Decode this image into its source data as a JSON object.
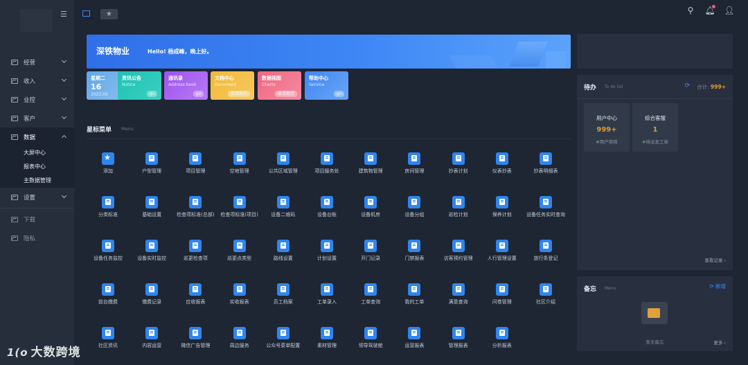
{
  "sidebar": {
    "items": [
      {
        "label": "经营"
      },
      {
        "label": "收入"
      },
      {
        "label": "业控"
      },
      {
        "label": "客户"
      },
      {
        "label": "数据"
      },
      {
        "label": "设置"
      },
      {
        "label": "下载"
      },
      {
        "label": "隐私"
      }
    ],
    "sub_items": [
      {
        "label": "大屏中心"
      },
      {
        "label": "报表中心"
      },
      {
        "label": "主数据管理"
      }
    ]
  },
  "banner": {
    "brand": "深铁物业",
    "greeting": "Hello! 杨成峰，晚上好。"
  },
  "quick_cards": [
    {
      "title": "星期二",
      "num": "16",
      "sub": "2023.05",
      "color": "#5fa6e8"
    },
    {
      "title": "资讯公告",
      "sub": "Notice",
      "go": "go",
      "color": "#1fc2b4"
    },
    {
      "title": "通讯录",
      "sub": "Address book",
      "go": "go",
      "color": "#a55ef0"
    },
    {
      "title": "文档中心",
      "sub": "Document",
      "go": "敬请期待",
      "color": "#f2b83a"
    },
    {
      "title": "数据视图",
      "sub": "Charts",
      "go": "敬请期待",
      "color": "#f07088"
    },
    {
      "title": "帮助中心",
      "sub": "Service",
      "go": "go",
      "color": "#4a8ef2"
    }
  ],
  "menu_section": {
    "title": "星标菜单",
    "sub": "Menu"
  },
  "menu_items": [
    "添加",
    "户型管理",
    "项目管理",
    "空地管理",
    "公共区域管理",
    "项目服务处",
    "建筑物管理",
    "房间管理",
    "抄表计划",
    "仪表抄表",
    "抄表明细表",
    "分类标准",
    "基础设置",
    "检查项标准(总部)",
    "检查项标准(项目)",
    "设备二维码",
    "设备台账",
    "设备机房",
    "设备分组",
    "巡检计划",
    "保养计划",
    "设备任务实时查询",
    "设备任务监控",
    "设备实时监控",
    "巡更检查项",
    "巡更点类型",
    "路线设置",
    "计划设置",
    "开门记录",
    "门禁报表",
    "访客预约管理",
    "人行管理设置",
    "放行条登记",
    "前台缴费",
    "缴费记录",
    "应收报表",
    "实收报表",
    "员工档案",
    "工单录入",
    "工单查询",
    "我的工单",
    "满意查询",
    "问卷管理",
    "社区介绍",
    "社区资讯",
    "内容运营",
    "微信广告管理",
    "周边服务",
    "公众号菜单配置",
    "素材管理",
    "领导驾驶舱",
    "运营报表",
    "管理报表",
    "分析报表"
  ],
  "todo": {
    "title": "待办",
    "sub": "To do list",
    "total_label": "合计:",
    "total_value": "999+",
    "cards": [
      {
        "name": "用户中心",
        "value": "999+",
        "desc": "#用户审核"
      },
      {
        "name": "综合客服",
        "value": "1",
        "desc": "#待派发工单"
      }
    ],
    "more": "查看记录 ›"
  },
  "memo": {
    "title": "备忘",
    "sub": "Menu",
    "new_label": "新增",
    "empty": "暂无备忘",
    "more": "更多 ›"
  },
  "watermark": {
    "logo": "1(o",
    "text": "大数跨境"
  }
}
